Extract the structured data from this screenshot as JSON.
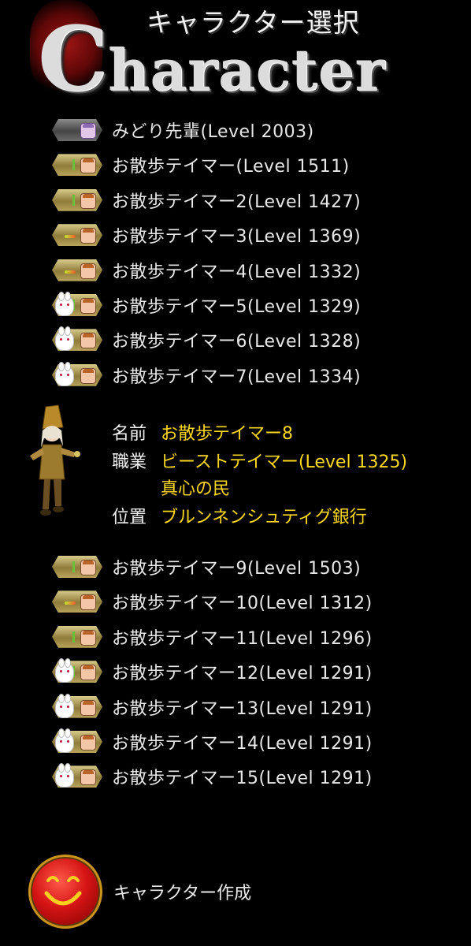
{
  "header": {
    "subtitle": "キャラクター選択",
    "title_initial": "C",
    "title_rest": "haracter"
  },
  "characters_top": [
    {
      "label": "みどり先輩(Level 2003)",
      "badge": "grey-purple"
    },
    {
      "label": "お散歩テイマー(Level 1511)",
      "badge": "tick"
    },
    {
      "label": "お散歩テイマー2(Level 1427)",
      "badge": "tick"
    },
    {
      "label": "お散歩テイマー3(Level 1369)",
      "badge": "spark"
    },
    {
      "label": "お散歩テイマー4(Level 1332)",
      "badge": "spark"
    },
    {
      "label": "お散歩テイマー5(Level 1329)",
      "badge": "bunny-tick"
    },
    {
      "label": "お散歩テイマー6(Level 1328)",
      "badge": "bunny"
    },
    {
      "label": "お散歩テイマー7(Level 1334)",
      "badge": "bunny"
    }
  ],
  "selected": {
    "name_label": "名前",
    "name": "お散歩テイマー8",
    "job_label": "職業",
    "job": "ビーストテイマー(Level 1325)",
    "title": "真心の民",
    "location_label": "位置",
    "location": "ブルンネンシュティグ銀行"
  },
  "characters_bottom": [
    {
      "label": "お散歩テイマー9(Level 1503)",
      "badge": "tick"
    },
    {
      "label": "お散歩テイマー10(Level 1312)",
      "badge": "spark"
    },
    {
      "label": "お散歩テイマー11(Level 1296)",
      "badge": "tick"
    },
    {
      "label": "お散歩テイマー12(Level 1291)",
      "badge": "bunny-tick"
    },
    {
      "label": "お散歩テイマー13(Level 1291)",
      "badge": "bunny"
    },
    {
      "label": "お散歩テイマー14(Level 1291)",
      "badge": "bunny"
    },
    {
      "label": "お散歩テイマー15(Level 1291)",
      "badge": "bunny"
    }
  ],
  "create_button": {
    "label": "キャラクター作成",
    "icon": "smiley-icon"
  },
  "colors": {
    "background": "#000000",
    "text": "#e8e8e8",
    "highlight": "#ffd820",
    "badge_gold": "#b9a45c"
  }
}
